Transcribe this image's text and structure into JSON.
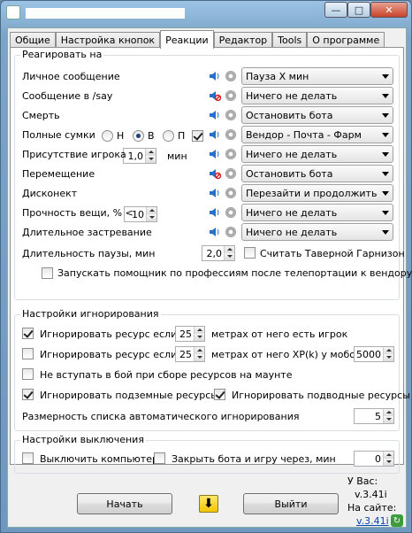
{
  "titlebar": {
    "minimize": "—",
    "maximize": "□",
    "close": "✕"
  },
  "tabs": [
    {
      "label": "Общие"
    },
    {
      "label": "Настройка кнопок"
    },
    {
      "label": "Реакции"
    },
    {
      "label": "Редактор"
    },
    {
      "label": "Tools"
    },
    {
      "label": "О программе"
    }
  ],
  "reactions": {
    "title": "Реагировать на",
    "rows": [
      {
        "label": "Личное сообщение",
        "sound": "on",
        "action": "Пауза X мин"
      },
      {
        "label": "Сообщение в /say",
        "sound": "muted",
        "action": "Ничего не делать"
      },
      {
        "label": "Смерть",
        "sound": "on",
        "action": "Остановить бота"
      },
      {
        "label": "Полные сумки",
        "sound": "on",
        "action": "Вендор - Почта - Фарм"
      },
      {
        "label": "Присутствие игрока",
        "sound": "on",
        "action": "Ничего не делать"
      },
      {
        "label": "Перемещение",
        "sound": "muted",
        "action": "Остановить бота"
      },
      {
        "label": "Дисконект",
        "sound": "on",
        "action": "Перезайти и продолжить"
      },
      {
        "label": "Прочность вещи, % <",
        "sound": "on",
        "action": "Ничего не делать"
      },
      {
        "label": "Длительное застревание",
        "sound": "on",
        "action": "Ничего не делать"
      }
    ],
    "radios": [
      {
        "label": "Н",
        "checked": false
      },
      {
        "label": "В",
        "checked": true
      },
      {
        "label": "П",
        "checked": false
      }
    ],
    "bags_checkbox_checked": true,
    "player_presence_value": "1,0",
    "player_presence_unit": "мин",
    "durability_value": "10",
    "pause_label": "Длительность паузы, мин",
    "pause_value": "2,0",
    "tavern_label": "Считать Таверной Гарнизон",
    "tavern_checked": false,
    "professions_label": "Запускать помощник по профессиям после телепортации к вендору",
    "professions_checked": false
  },
  "ignore": {
    "title": "Настройки игнорирования",
    "row1": {
      "prefix": "Игнорировать ресурс если в",
      "value": "25",
      "suffix": "метрах от него есть игрок",
      "checked": true
    },
    "row2": {
      "prefix": "Игнорировать ресурс если в",
      "value": "25",
      "suffix": "метрах от него XP(k) у мобов >",
      "xp_value": "5000",
      "checked": false
    },
    "row3": {
      "label": "Не вступать в бой при сборе ресурсов на маунте",
      "checked": false
    },
    "row4": {
      "label": "Игнорировать подземные ресурсы",
      "checked": true
    },
    "row5": {
      "label": "Игнорировать подводные ресурсы",
      "checked": true
    },
    "list_size_label": "Размерность списка автоматического игнорирования",
    "list_size_value": "5"
  },
  "shutdown": {
    "title": "Настройки выключения",
    "shutdown_pc": "Выключить компьютер",
    "shutdown_pc_checked": false,
    "close_bot": "Закрыть бота и игру через, мин",
    "close_bot_checked": false,
    "close_bot_value": "0"
  },
  "footer": {
    "start": "Начать",
    "download_icon": "down-arrow-icon",
    "exit": "Выйти",
    "you_have": "У Вас:",
    "local_version": "v.3.41i",
    "on_site": "На сайте:",
    "site_version": "v.3.41i"
  }
}
